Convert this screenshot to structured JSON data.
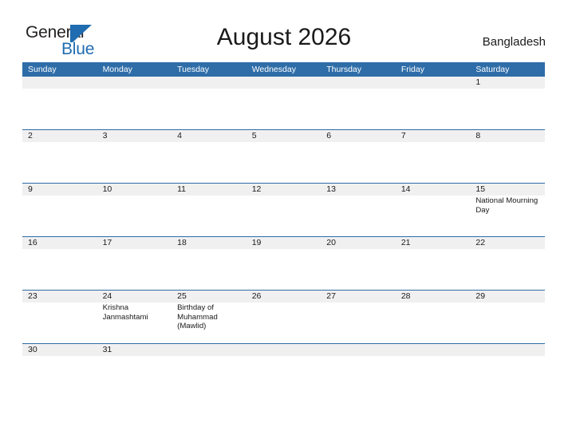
{
  "brand": {
    "name_dark": "General",
    "name_blue": "Blue",
    "mark": "blue-triangle-flag",
    "color_dark": "#231f20",
    "color_blue": "#1f6cb0"
  },
  "header": {
    "title": "August 2026",
    "country": "Bangladesh"
  },
  "colors": {
    "header_blue": "#2e6da8",
    "row_divider_blue": "#2e6da8",
    "date_band_gray": "#f0f0f0",
    "text": "#1a1a1a"
  },
  "calendar": {
    "day_names": [
      "Sunday",
      "Monday",
      "Tuesday",
      "Wednesday",
      "Thursday",
      "Friday",
      "Saturday"
    ],
    "weeks": [
      {
        "days": [
          {
            "num": "",
            "events": []
          },
          {
            "num": "",
            "events": []
          },
          {
            "num": "",
            "events": []
          },
          {
            "num": "",
            "events": []
          },
          {
            "num": "",
            "events": []
          },
          {
            "num": "",
            "events": []
          },
          {
            "num": "1",
            "events": []
          }
        ]
      },
      {
        "days": [
          {
            "num": "2",
            "events": []
          },
          {
            "num": "3",
            "events": []
          },
          {
            "num": "4",
            "events": []
          },
          {
            "num": "5",
            "events": []
          },
          {
            "num": "6",
            "events": []
          },
          {
            "num": "7",
            "events": []
          },
          {
            "num": "8",
            "events": []
          }
        ]
      },
      {
        "days": [
          {
            "num": "9",
            "events": []
          },
          {
            "num": "10",
            "events": []
          },
          {
            "num": "11",
            "events": []
          },
          {
            "num": "12",
            "events": []
          },
          {
            "num": "13",
            "events": []
          },
          {
            "num": "14",
            "events": []
          },
          {
            "num": "15",
            "events": [
              "National Mourning Day"
            ]
          }
        ]
      },
      {
        "days": [
          {
            "num": "16",
            "events": []
          },
          {
            "num": "17",
            "events": []
          },
          {
            "num": "18",
            "events": []
          },
          {
            "num": "19",
            "events": []
          },
          {
            "num": "20",
            "events": []
          },
          {
            "num": "21",
            "events": []
          },
          {
            "num": "22",
            "events": []
          }
        ]
      },
      {
        "days": [
          {
            "num": "23",
            "events": []
          },
          {
            "num": "24",
            "events": [
              "Krishna Janmashtami"
            ]
          },
          {
            "num": "25",
            "events": [
              "Birthday of Muhammad (Mawlid)"
            ]
          },
          {
            "num": "26",
            "events": []
          },
          {
            "num": "27",
            "events": []
          },
          {
            "num": "28",
            "events": []
          },
          {
            "num": "29",
            "events": []
          }
        ]
      },
      {
        "days": [
          {
            "num": "30",
            "events": []
          },
          {
            "num": "31",
            "events": []
          },
          {
            "num": "",
            "events": []
          },
          {
            "num": "",
            "events": []
          },
          {
            "num": "",
            "events": []
          },
          {
            "num": "",
            "events": []
          },
          {
            "num": "",
            "events": []
          }
        ]
      }
    ]
  }
}
